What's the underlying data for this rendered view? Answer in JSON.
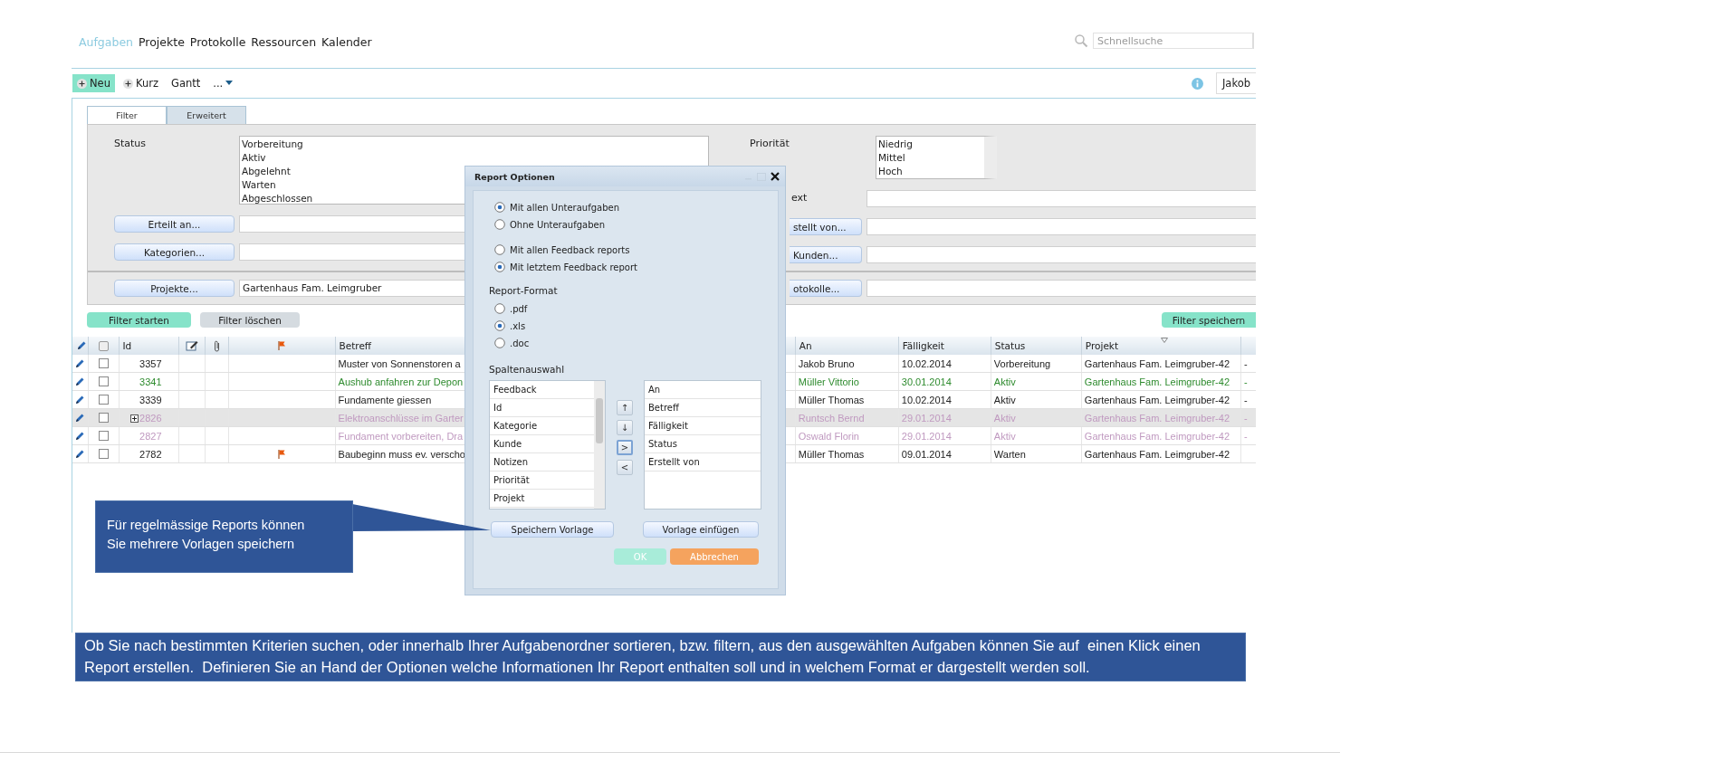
{
  "nav": {
    "tabs": [
      {
        "label": "Aufgaben",
        "selected": true
      },
      {
        "label": "Projekte",
        "selected": false
      },
      {
        "label": "Protokolle",
        "selected": false
      },
      {
        "label": "Ressourcen",
        "selected": false
      },
      {
        "label": "Kalender",
        "selected": false
      }
    ]
  },
  "search": {
    "placeholder": "Schnellsuche"
  },
  "toolbar": {
    "items": [
      {
        "label": "Neu",
        "kind": "add",
        "highlighted": true
      },
      {
        "label": "Kurz",
        "kind": "add",
        "highlighted": false
      },
      {
        "label": "Gantt",
        "kind": "plain",
        "highlighted": false
      },
      {
        "label": "...",
        "kind": "menu",
        "highlighted": false
      }
    ]
  },
  "user": {
    "name": "Jakob"
  },
  "filter_tabs": [
    {
      "label": "Filter",
      "selected": true
    },
    {
      "label": "Erweitert",
      "selected": false
    }
  ],
  "filter": {
    "status_label": "Status",
    "status_options": [
      "Vorbereitung",
      "Aktiv",
      "Abgelehnt",
      "Warten",
      "Abgeschlossen"
    ],
    "priority_label": "Priorität",
    "priority_options": [
      "Niedrig",
      "Mittel",
      "Hoch"
    ],
    "text_label": "ext",
    "left_rows": [
      {
        "button": "Erteilt an..."
      },
      {
        "button": "Kategorien..."
      }
    ],
    "left_bottom": {
      "button": "Projekte...",
      "value": "Gartenhaus Fam. Leimgruber"
    },
    "right_rows": [
      {
        "button": "stellt von..."
      },
      {
        "button": "Kunden..."
      }
    ],
    "right_bottom": {
      "button": "otokolle..."
    }
  },
  "filter_actions": [
    {
      "label": "Filter starten",
      "kind": "primary"
    },
    {
      "label": "Filter löschen",
      "kind": "secondary"
    }
  ],
  "save_filter": "Filter speichern",
  "table": {
    "columns": [
      {
        "label": "Id",
        "sorted": false
      },
      {
        "label": "Betreff",
        "sorted": false
      },
      {
        "label": "An",
        "sorted": false
      },
      {
        "label": "Fälligkeit",
        "sorted": false
      },
      {
        "label": "Status",
        "sorted": false
      },
      {
        "label": "Projekt",
        "sorted": true
      }
    ],
    "rows": [
      {
        "id": "3357",
        "subject": "Muster von Sonnenstoren a",
        "assignee": "Jakob Bruno",
        "due": "10.02.2014",
        "status": "Vorbereitung",
        "project": "Gartenhaus Fam. Leimgruber-42",
        "column_11": "-",
        "color": "#222222",
        "selected": false,
        "expandable": false,
        "flagged": false
      },
      {
        "id": "3341",
        "subject": "Aushub anfahren zur Depon",
        "assignee": "Müller Vittorio",
        "due": "30.01.2014",
        "status": "Aktiv",
        "project": "Gartenhaus Fam. Leimgruber-42",
        "column_11": "-",
        "color": "#2e8b2e",
        "selected": false,
        "expandable": false,
        "flagged": false
      },
      {
        "id": "3339",
        "subject": "Fundamente giessen",
        "assignee": "Müller Thomas",
        "due": "10.02.2014",
        "status": "Aktiv",
        "project": "Gartenhaus Fam. Leimgruber-42",
        "column_11": "-",
        "color": "#222222",
        "selected": false,
        "expandable": false,
        "flagged": false
      },
      {
        "id": "2826",
        "subject": "Elektroanschlüsse im Garter",
        "assignee": "Runtsch Bernd",
        "due": "29.01.2014",
        "status": "Aktiv",
        "project": "Gartenhaus Fam. Leimgruber-42",
        "column_11": "-",
        "color": "#c09ac0",
        "selected": true,
        "expandable": true,
        "flagged": false
      },
      {
        "id": "2827",
        "subject": "Fundament vorbereiten, Dra",
        "assignee": "Oswald Florin",
        "due": "29.01.2014",
        "status": "Aktiv",
        "project": "Gartenhaus Fam. Leimgruber-42",
        "column_11": "-",
        "color": "#c09ac0",
        "selected": false,
        "expandable": false,
        "flagged": false
      },
      {
        "id": "2782",
        "subject": "Baubeginn muss ev. verscho",
        "assignee": "Müller Thomas",
        "due": "09.01.2014",
        "status": "Warten",
        "project": "Gartenhaus Fam. Leimgruber-42",
        "color": "#222222",
        "selected": false,
        "expandable": false,
        "flagged": true
      }
    ]
  },
  "dialog": {
    "title": "Report Optionen",
    "subtask_options": [
      {
        "label": "Mit allen Unteraufgaben",
        "selected": true
      },
      {
        "label": "Ohne Unteraufgaben",
        "selected": false
      }
    ],
    "feedback_options": [
      {
        "label": "Mit allen Feedback reports",
        "selected": false
      },
      {
        "label": "Mit letztem Feedback report",
        "selected": true
      }
    ],
    "format_label": "Report-Format",
    "formats": [
      {
        "label": ".pdf",
        "selected": false
      },
      {
        "label": ".xls",
        "selected": true
      },
      {
        "label": ".doc",
        "selected": false
      }
    ],
    "columns_label": "Spaltenauswahl",
    "available_columns": [
      "Feedback",
      "Id",
      "Kategorie",
      "Kunde",
      "Notizen",
      "Priorität",
      "Projekt"
    ],
    "selected_columns": [
      "An",
      "Betreff",
      "Fälligkeit",
      "Status",
      "Erstellt von"
    ],
    "move_buttons": [
      {
        "label": "↑",
        "focused": false
      },
      {
        "label": "↓",
        "focused": false
      },
      {
        "label": ">",
        "focused": true
      },
      {
        "label": "<",
        "focused": false
      }
    ],
    "template_buttons": [
      "Speichern Vorlage",
      "Vorlage einfügen"
    ],
    "ok": {
      "label": "OK",
      "disabled": true
    },
    "cancel": {
      "label": "Abbrechen"
    }
  },
  "callout": {
    "text": "Für regelmässige Reports können Sie mehrere Vorlagen speichern"
  },
  "info_box": {
    "text": "Ob Sie nach bestimmten Kriterien suchen, oder innerhalb Ihrer Aufgabenordner sortieren, bzw. filtern, aus den ausgewählten Aufgaben können Sie auf  einen Klick einen Report erstellen.  Definieren Sie an Hand der Optionen welche Informationen Ihr Report enthalten soll und in welchem Format er dargestellt werden soll."
  }
}
